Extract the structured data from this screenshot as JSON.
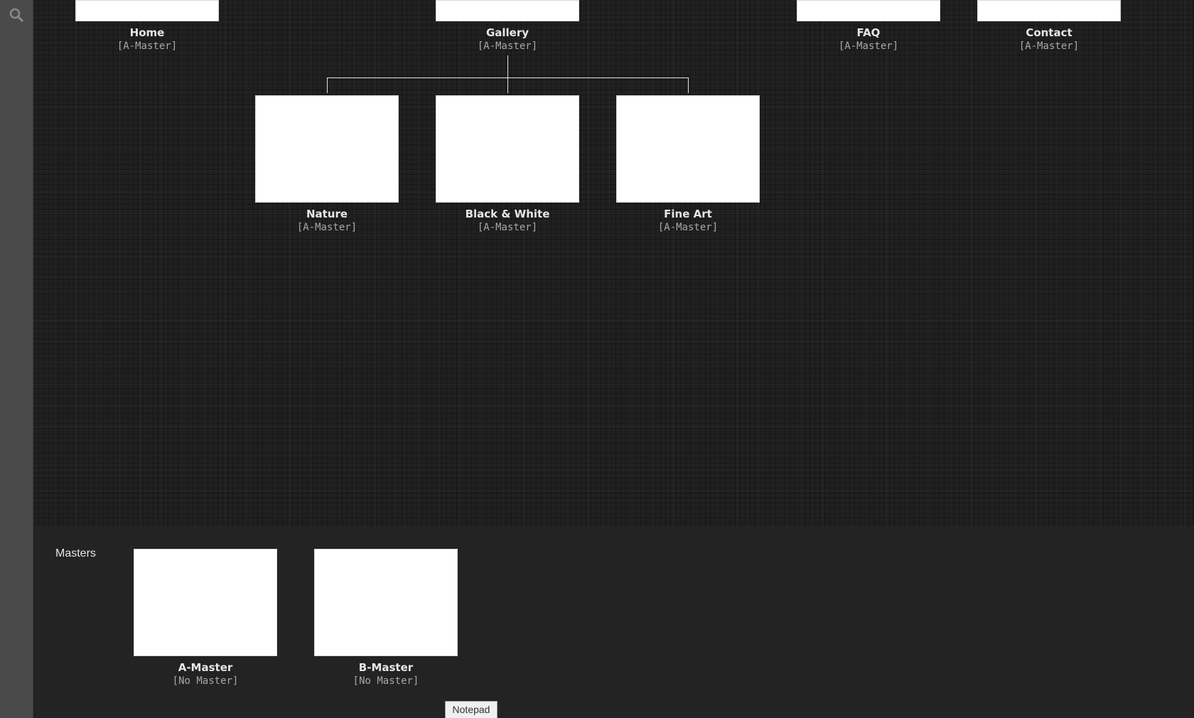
{
  "sitemap": {
    "top_pages": [
      {
        "title": "Home",
        "master": "[A-Master]"
      },
      {
        "title": "Gallery",
        "master": "[A-Master]"
      },
      {
        "title": "FAQ",
        "master": "[A-Master]"
      },
      {
        "title": "Contact",
        "master": "[A-Master]"
      }
    ],
    "gallery_children": [
      {
        "title": "Nature",
        "master": "[A-Master]"
      },
      {
        "title": "Black & White",
        "master": "[A-Master]"
      },
      {
        "title": "Fine Art",
        "master": "[A-Master]"
      }
    ]
  },
  "masters": {
    "label": "Masters",
    "items": [
      {
        "title": "A-Master",
        "master": "[No Master]"
      },
      {
        "title": "B-Master",
        "master": "[No Master]"
      }
    ]
  },
  "notepad": {
    "label": "Notepad"
  },
  "colors": {
    "background": "#232323",
    "rail": "#4a4a4a",
    "thumbnail": "#ffffff"
  }
}
